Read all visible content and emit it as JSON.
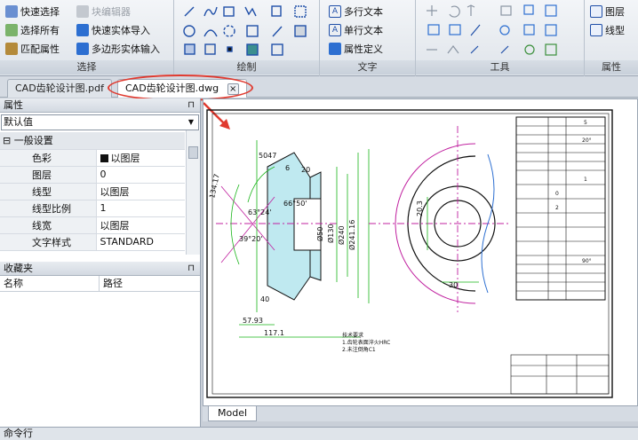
{
  "ribbon": {
    "select": {
      "title": "选择",
      "quick_select": "快速选择",
      "block_editor": "块编辑器",
      "select_all": "选择所有",
      "quick_import": "快速实体导入",
      "match_props": "匹配属性",
      "polygon_import": "多边形实体输入"
    },
    "draw": {
      "title": "绘制"
    },
    "text": {
      "title": "文字",
      "mtext": "多行文本",
      "stext": "单行文本",
      "attdef": "属性定义"
    },
    "tools": {
      "title": "工具"
    },
    "props": {
      "title": "属性",
      "layer": "图层",
      "linetype": "线型"
    }
  },
  "tabs": [
    {
      "label": "CAD齿轮设计图.pdf"
    },
    {
      "label": "CAD齿轮设计图.dwg",
      "close": "×"
    }
  ],
  "properties": {
    "title": "属性",
    "pin": "⊓",
    "combo_value": "默认值",
    "section": "一般设置",
    "section_toggle": "⊟",
    "rows": [
      {
        "name": "色彩",
        "value": "以图层"
      },
      {
        "name": "图层",
        "value": "0"
      },
      {
        "name": "线型",
        "value": "以图层"
      },
      {
        "name": "线型比例",
        "value": "1"
      },
      {
        "name": "线宽",
        "value": "以图层"
      },
      {
        "name": "文字样式",
        "value": "STANDARD"
      }
    ]
  },
  "favorites": {
    "title": "收藏夹",
    "pin": "⊓",
    "col_name": "名称",
    "col_path": "路径"
  },
  "drawing": {
    "dims": {
      "d_5047": "5047",
      "d_134_17": "134.17",
      "d_63_24": "63°24'",
      "d_66_50": "66°50'",
      "d_20": "20",
      "d_6": "6",
      "d_39_20": "39°20'",
      "d_50": "Ø50",
      "d_130": "Ø130",
      "d_240": "Ø240",
      "d_241_16": "Ø241.16",
      "d_57_93": "57.93",
      "d_117_1": "117.1",
      "d_40": "40",
      "d_20_3": "20.3",
      "d_30": "30"
    },
    "notes": [
      "技术要求",
      "1.齿轮表面淬火HRC",
      "2.未注倒角C1"
    ],
    "table_values": [
      "5",
      "20°",
      "1",
      "0",
      "2",
      "90°"
    ]
  },
  "model_tab": "Model",
  "command_line": "命令行",
  "colors": {
    "highlight": "#e03a2f",
    "ribbon_bg": "#e6eaf0",
    "accent_blue": "#2d6fd1"
  }
}
